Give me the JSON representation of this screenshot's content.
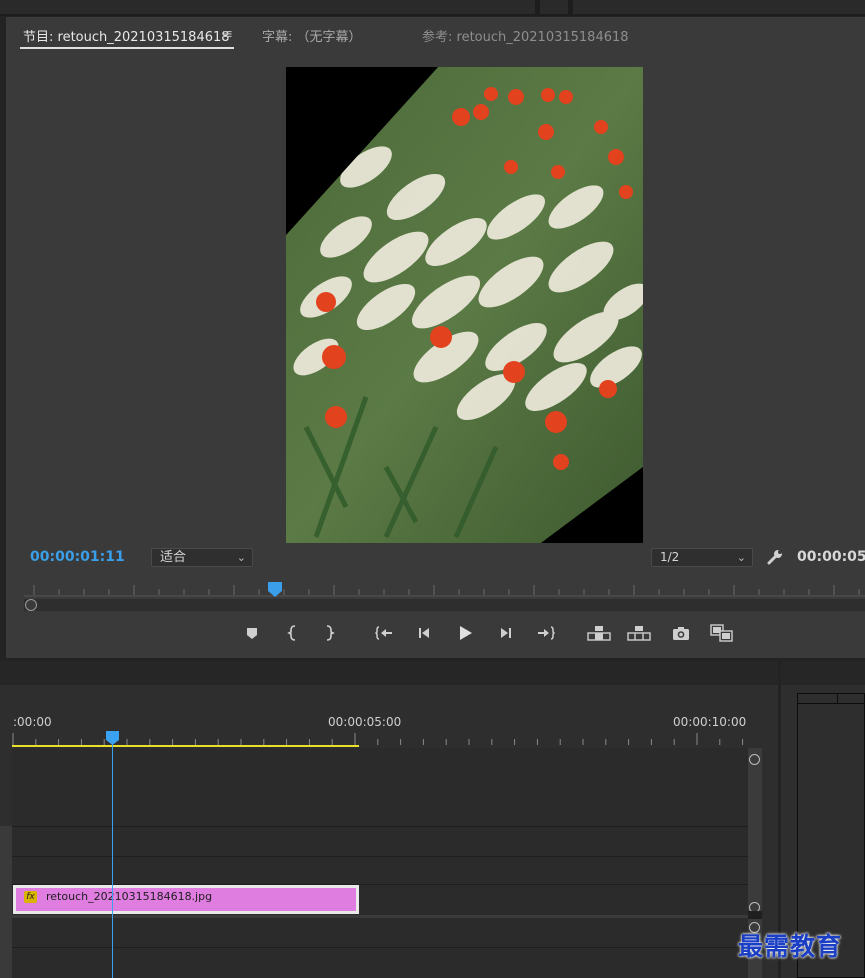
{
  "monitor": {
    "tabs": [
      {
        "label": "节目: retouch_20210315184618"
      },
      {
        "label": "字幕: （无字幕）"
      },
      {
        "label": "参考: retouch_20210315184618"
      }
    ],
    "timecode_current": "00:00:01:11",
    "fit_value": "适合",
    "resolution_value": "1/2",
    "timecode_duration": "00:00:05",
    "playhead_position": 0.3
  },
  "controls": [
    {
      "name": "add-marker",
      "icon": "marker-icon"
    },
    {
      "name": "mark-in",
      "icon": "mark-in-icon"
    },
    {
      "name": "mark-out",
      "icon": "mark-out-icon"
    },
    {
      "name": "go-to-in",
      "icon": "go-to-in-icon"
    },
    {
      "name": "step-back",
      "icon": "step-back-icon"
    },
    {
      "name": "play",
      "icon": "play-icon"
    },
    {
      "name": "step-forward",
      "icon": "step-forward-icon"
    },
    {
      "name": "go-to-out",
      "icon": "go-to-out-icon"
    },
    {
      "name": "lift",
      "icon": "lift-icon"
    },
    {
      "name": "extract",
      "icon": "extract-icon"
    },
    {
      "name": "export-frame",
      "icon": "camera-icon"
    },
    {
      "name": "compare-view",
      "icon": "compare-icon"
    }
  ],
  "timeline": {
    "ruler_labels": [
      ":00:00",
      "00:00:05:00",
      "00:00:10:00"
    ],
    "clip": {
      "name": "retouch_20210315184618.jpg",
      "badge": "fx",
      "color": "#e07de0"
    },
    "playhead_color": "#3aa2f0",
    "work_area_color": "#e9de2a"
  },
  "watermark": "最需教育",
  "colors": {
    "accent": "#3a9ee8"
  }
}
